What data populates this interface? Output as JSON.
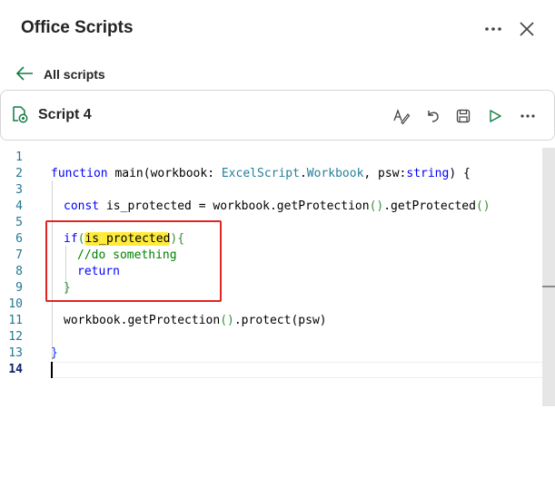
{
  "header": {
    "title": "Office Scripts",
    "more_icon": "more-horizontal-icon",
    "close_icon": "close-icon"
  },
  "nav": {
    "back_icon": "arrow-left-icon",
    "back_label": "All scripts"
  },
  "script": {
    "icon": "script-file-icon",
    "name": "Script 4",
    "tools": [
      "spell-check-icon",
      "undo-icon",
      "save-icon",
      "run-icon",
      "more-horizontal-icon"
    ]
  },
  "editor": {
    "line_numbers": [
      "1",
      "2",
      "3",
      "4",
      "5",
      "6",
      "7",
      "8",
      "9",
      "10",
      "11",
      "12",
      "13",
      "14"
    ],
    "current_line": "14",
    "code": {
      "l2_kw": "function",
      "l2_a": " main(workbook: ",
      "l2_type1": "ExcelScript",
      "l2_dot": ".",
      "l2_type2": "Workbook",
      "l2_b": ", psw:",
      "l2_type3": "string",
      "l2_c": ") {",
      "l4_kw": "const",
      "l4_a": " is_protected = workbook.getProtection",
      "l4_p1": "()",
      "l4_b": ".getProtected",
      "l4_p2": "()",
      "l6_kw": "if",
      "l6_open": "(",
      "l6_var": "is_protected",
      "l6_close": ")",
      "l6_brace": "{",
      "l7_comment": "//do something",
      "l8_kw": "return",
      "l9_brace": "}",
      "l11_a": "workbook.getProtection",
      "l11_p1": "()",
      "l11_b": ".protect",
      "l11_p2": "(psw)",
      "l13_brace": "}"
    },
    "colors": {
      "keyword": "#0000ff",
      "type": "#267f99",
      "comment": "#008000",
      "highlight": "#ffeb3b",
      "annotation_box": "#e02424"
    }
  }
}
